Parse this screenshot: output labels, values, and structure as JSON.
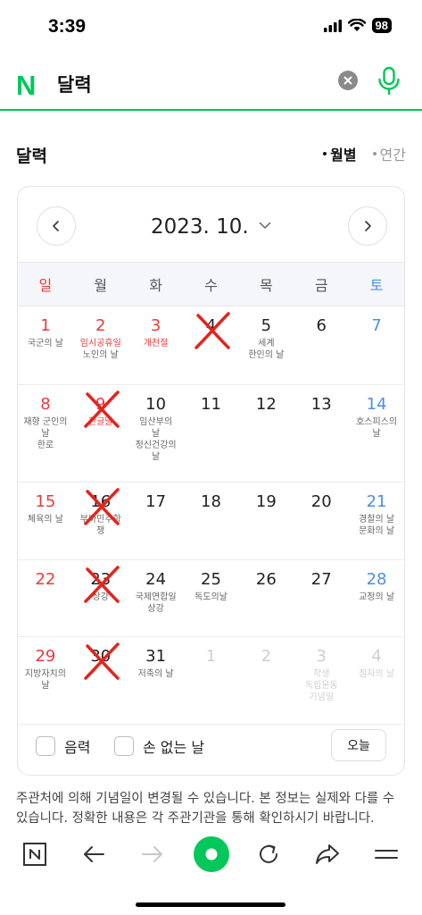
{
  "status": {
    "time": "3:39",
    "battery": "98"
  },
  "search": {
    "logo": "N",
    "query": "달력"
  },
  "calendar_header": {
    "title": "달력",
    "views": [
      {
        "label": "월별",
        "active": true
      },
      {
        "label": "연간",
        "active": false
      }
    ]
  },
  "month_label": "2023. 10.",
  "weekdays": [
    "일",
    "월",
    "화",
    "수",
    "목",
    "금",
    "토"
  ],
  "weeks": [
    [
      {
        "day": "1",
        "color": "red",
        "events": [
          {
            "text": "국군의 날",
            "color": "gray-text"
          }
        ]
      },
      {
        "day": "2",
        "color": "red",
        "events": [
          {
            "text": "임시공휴일",
            "color": "red"
          },
          {
            "text": "노인의 날",
            "color": "normal"
          }
        ]
      },
      {
        "day": "3",
        "color": "red",
        "events": [
          {
            "text": "개천절",
            "color": "red"
          }
        ]
      },
      {
        "day": "4",
        "color": "normal",
        "crossed": true,
        "events": []
      },
      {
        "day": "5",
        "color": "normal",
        "events": [
          {
            "text": "세계",
            "color": "normal"
          },
          {
            "text": "한인의 날",
            "color": "normal"
          }
        ]
      },
      {
        "day": "6",
        "color": "normal",
        "events": []
      },
      {
        "day": "7",
        "color": "blue",
        "events": []
      }
    ],
    [
      {
        "day": "8",
        "color": "red",
        "events": [
          {
            "text": "재향 군인의",
            "color": "normal"
          },
          {
            "text": "날",
            "color": "normal"
          },
          {
            "text": "한로",
            "color": "normal"
          }
        ]
      },
      {
        "day": "9",
        "color": "red",
        "crossed": true,
        "events": [
          {
            "text": "한글날",
            "color": "red"
          }
        ]
      },
      {
        "day": "10",
        "color": "normal",
        "events": [
          {
            "text": "임산부의",
            "color": "normal"
          },
          {
            "text": "날",
            "color": "normal"
          },
          {
            "text": "정신건강의",
            "color": "normal"
          },
          {
            "text": "날",
            "color": "normal"
          }
        ]
      },
      {
        "day": "11",
        "color": "normal",
        "events": []
      },
      {
        "day": "12",
        "color": "normal",
        "events": []
      },
      {
        "day": "13",
        "color": "normal",
        "events": []
      },
      {
        "day": "14",
        "color": "blue",
        "events": [
          {
            "text": "호스피스의",
            "color": "normal"
          },
          {
            "text": "날",
            "color": "normal"
          }
        ]
      }
    ],
    [
      {
        "day": "15",
        "color": "red",
        "events": [
          {
            "text": "체육의 날",
            "color": "normal"
          }
        ]
      },
      {
        "day": "16",
        "color": "normal",
        "crossed": true,
        "events": [
          {
            "text": "부마민주항",
            "color": "normal"
          },
          {
            "text": "쟁",
            "color": "normal"
          }
        ]
      },
      {
        "day": "17",
        "color": "normal",
        "events": []
      },
      {
        "day": "18",
        "color": "normal",
        "events": []
      },
      {
        "day": "19",
        "color": "normal",
        "events": []
      },
      {
        "day": "20",
        "color": "normal",
        "events": []
      },
      {
        "day": "21",
        "color": "blue",
        "events": [
          {
            "text": "경찰의 날",
            "color": "normal"
          },
          {
            "text": "문화의 날",
            "color": "normal"
          }
        ]
      }
    ],
    [
      {
        "day": "22",
        "color": "red",
        "events": []
      },
      {
        "day": "23",
        "color": "normal",
        "crossed": true,
        "events": [
          {
            "text": "상강",
            "color": "normal"
          }
        ]
      },
      {
        "day": "24",
        "color": "normal",
        "events": [
          {
            "text": "국제연합일",
            "color": "normal"
          },
          {
            "text": "상강",
            "color": "normal"
          }
        ]
      },
      {
        "day": "25",
        "color": "normal",
        "events": [
          {
            "text": "독도의날",
            "color": "normal"
          }
        ]
      },
      {
        "day": "26",
        "color": "normal",
        "events": []
      },
      {
        "day": "27",
        "color": "normal",
        "events": []
      },
      {
        "day": "28",
        "color": "blue",
        "events": [
          {
            "text": "교정의 날",
            "color": "normal"
          }
        ]
      }
    ],
    [
      {
        "day": "29",
        "color": "red",
        "events": [
          {
            "text": "지방자치의",
            "color": "normal"
          },
          {
            "text": "날",
            "color": "normal"
          }
        ]
      },
      {
        "day": "30",
        "color": "normal",
        "crossed": true,
        "events": []
      },
      {
        "day": "31",
        "color": "normal",
        "events": [
          {
            "text": "저축의 날",
            "color": "normal"
          }
        ]
      },
      {
        "day": "1",
        "color": "gray",
        "events": []
      },
      {
        "day": "2",
        "color": "gray",
        "events": []
      },
      {
        "day": "3",
        "color": "gray",
        "events": [
          {
            "text": "학생",
            "color": "gray"
          },
          {
            "text": "독립운동",
            "color": "gray"
          },
          {
            "text": "기념일",
            "color": "gray"
          }
        ]
      },
      {
        "day": "4",
        "color": "gray",
        "events": [
          {
            "text": "점자의 날",
            "color": "gray"
          }
        ]
      }
    ]
  ],
  "options": {
    "lunar_label": "음력",
    "nohands_label": "손 없는 날",
    "today_label": "오늘"
  },
  "notice": "주관처에 의해 기념일이 변경될 수 있습니다. 본 정보는 실제와 다를 수 있습니다. 정확한 내용은 각 주관기관을 통해 확인하시기 바랍니다.",
  "colors": {
    "brand": "#03c75a",
    "sunday": "#e83c3c",
    "saturday": "#4a90e2",
    "mark": "#e5231b"
  }
}
